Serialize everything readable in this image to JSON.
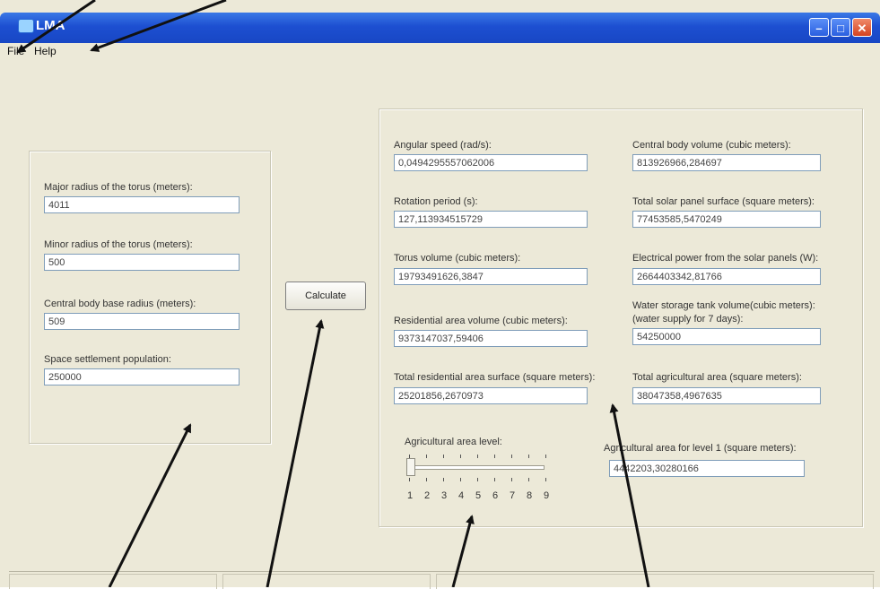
{
  "window": {
    "title": "LMA"
  },
  "menu": {
    "items": [
      "File",
      "Help"
    ]
  },
  "left_group": {
    "fields": [
      {
        "label": "Major radius of the torus (meters):",
        "value": "4011"
      },
      {
        "label": "Minor radius of the torus (meters):",
        "value": "500"
      },
      {
        "label": "Central body base radius (meters):",
        "value": "509"
      },
      {
        "label": "Space settlement population:",
        "value": "250000"
      }
    ]
  },
  "calculate": {
    "label": "Calculate"
  },
  "results": {
    "left_col": [
      {
        "label": "Angular speed (rad/s):",
        "value": "0,0494295557062006"
      },
      {
        "label": "Rotation period (s):",
        "value": "127,113934515729"
      },
      {
        "label": "Torus volume (cubic meters):",
        "value": "19793491626,3847"
      },
      {
        "label": "Residential area volume (cubic meters):",
        "value": "9373147037,59406"
      },
      {
        "label": "Total residential area surface (square meters):",
        "value": "25201856,2670973"
      }
    ],
    "right_col": [
      {
        "label": "Central body volume (cubic meters):",
        "value": "813926966,284697"
      },
      {
        "label": "Total solar panel surface (square meters):",
        "value": "77453585,5470249"
      },
      {
        "label": "Electrical power from the solar panels (W):",
        "value": "2664403342,81766"
      },
      {
        "label": "Water storage tank volume(cubic meters):",
        "label2": "(water supply for 7 days):",
        "value": "54250000"
      },
      {
        "label": "Total agricultural area (square meters):",
        "value": "38047358,4967635"
      }
    ],
    "slider": {
      "label": "Agricultural area level:",
      "ticks": [
        "1",
        "2",
        "3",
        "4",
        "5",
        "6",
        "7",
        "8",
        "9"
      ],
      "value": 1
    },
    "level_area": {
      "label": "Agricultural area for level 1 (square meters):",
      "value": "4442203,30280166"
    }
  },
  "colors": {
    "window_bg": "#ece9d8",
    "titlebar": "#1d4fd1",
    "arrow": "#111111"
  }
}
